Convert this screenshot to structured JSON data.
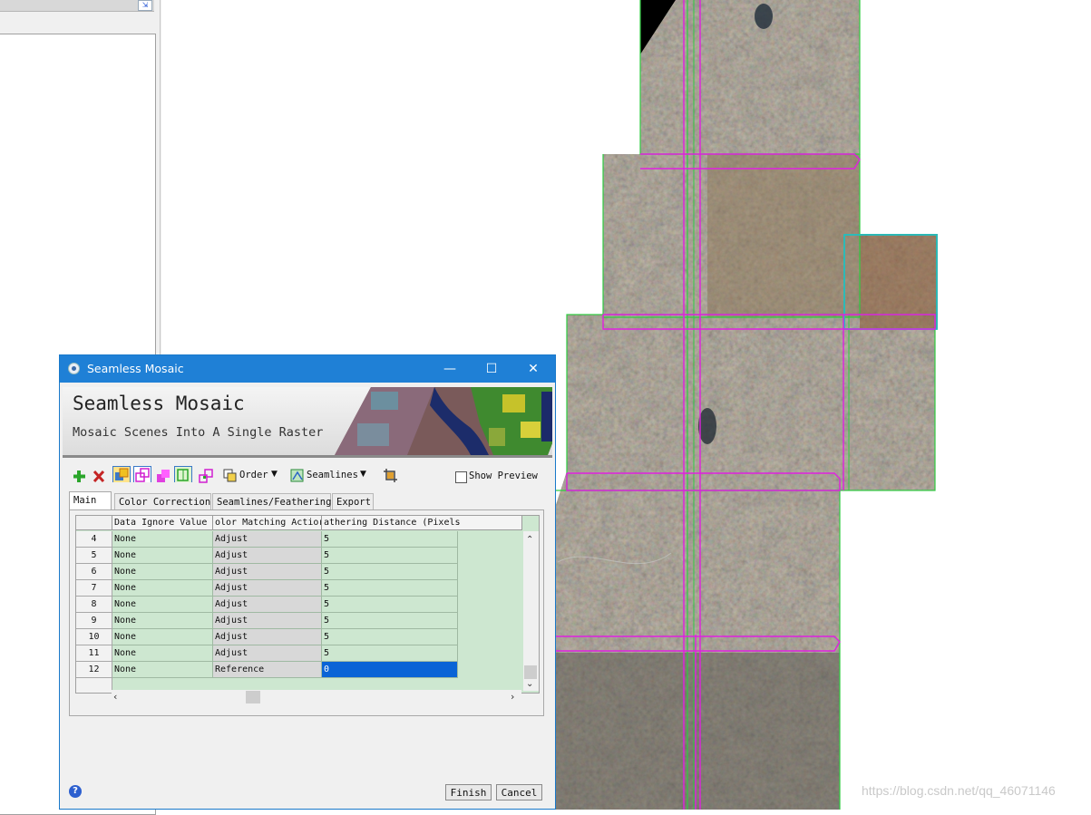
{
  "dialog": {
    "title": "Seamless Mosaic",
    "banner_title": "Seamless Mosaic",
    "banner_subtitle": "Mosaic Scenes Into A Single Raster"
  },
  "toolbar": {
    "order_label": "Order",
    "seamlines_label": "Seamlines",
    "show_preview_label": "Show Preview",
    "show_preview_checked": false
  },
  "tabs": [
    {
      "label": "Main",
      "active": true
    },
    {
      "label": "Color Correction",
      "active": false
    },
    {
      "label": "Seamlines/Feathering",
      "active": false
    },
    {
      "label": "Export",
      "active": false
    }
  ],
  "table": {
    "columns": [
      "Data Ignore Value",
      "olor Matching Actior",
      "athering Distance (Pixels"
    ],
    "rows": [
      {
        "id": "4",
        "ignore": "None",
        "action": "Adjust",
        "distance": "5"
      },
      {
        "id": "5",
        "ignore": "None",
        "action": "Adjust",
        "distance": "5"
      },
      {
        "id": "6",
        "ignore": "None",
        "action": "Adjust",
        "distance": "5"
      },
      {
        "id": "7",
        "ignore": "None",
        "action": "Adjust",
        "distance": "5"
      },
      {
        "id": "8",
        "ignore": "None",
        "action": "Adjust",
        "distance": "5"
      },
      {
        "id": "9",
        "ignore": "None",
        "action": "Adjust",
        "distance": "5"
      },
      {
        "id": "10",
        "ignore": "None",
        "action": "Adjust",
        "distance": "5"
      },
      {
        "id": "11",
        "ignore": "None",
        "action": "Adjust",
        "distance": "5"
      },
      {
        "id": "12",
        "ignore": "None",
        "action": "Reference",
        "distance": "0"
      }
    ],
    "selected_row": "12"
  },
  "buttons": {
    "finish": "Finish",
    "cancel": "Cancel"
  },
  "watermark": "https://blog.csdn.net/qq_46071146",
  "colors": {
    "titlebar": "#1f80d6",
    "grid_bg": "#cde7d0",
    "selection": "#0a63d6",
    "seamline_magenta": "#e020e0",
    "footprint_green": "#2ecc40",
    "footprint_cyan": "#20c0c0"
  }
}
